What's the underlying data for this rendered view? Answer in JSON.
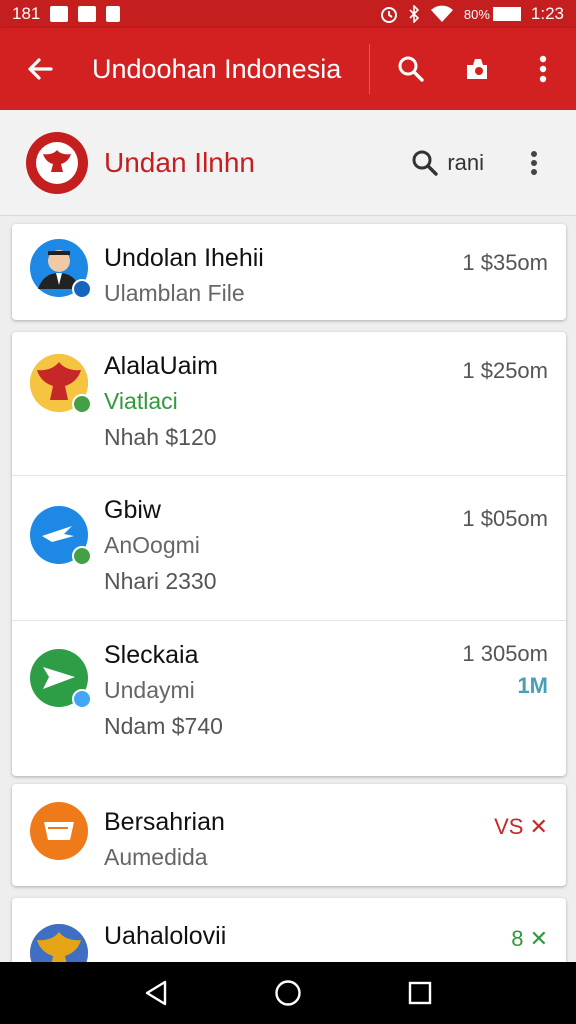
{
  "status_bar": {
    "left_text": "181",
    "battery": "80%",
    "time": "1:23"
  },
  "app_bar": {
    "title": "Undoohan Indonesia"
  },
  "subheader": {
    "title": "Undan Ilnhn",
    "search_label": "rani"
  },
  "items": [
    {
      "name": "Undolan Ihehii",
      "line2": "Ulamblan File",
      "line3": "",
      "meta": "1 $35om",
      "meta_color": "#555555",
      "avatar_color": "#1e88e5",
      "badge_color": "#1565c0"
    },
    {
      "name": "AlalaUaim",
      "line2": "Viatlaci",
      "line3": "Nhah $120",
      "meta": "1 $25om",
      "meta_color": "#555555",
      "avatar_color": "#e6a417",
      "badge_color": "#43a047",
      "line2_color": "#2e9a3a"
    },
    {
      "name": "Gbiw",
      "line2": "AnOogmi",
      "line3": "Nhari 2330",
      "meta": "1 $05om",
      "meta_color": "#555555",
      "avatar_color": "#1e88e5",
      "badge_color": "#43a047"
    },
    {
      "name": "Sleckaia",
      "line2": "Undaymi",
      "line3": "Ndam $740",
      "meta": "1 305om",
      "meta2": "1M",
      "meta_color": "#555555",
      "meta2_color": "#4a9fb8",
      "avatar_color": "#2e9e46",
      "badge_color": "#42a5f5"
    },
    {
      "name": "Bersahrian",
      "line2": "Aumedida",
      "line3": "",
      "meta": "VS ✕",
      "meta_color": "#c62828",
      "avatar_color": "#ef7a1a"
    },
    {
      "name": "Uahalolovii",
      "line2": "",
      "line3": "",
      "meta": "8 ✕",
      "meta_color": "#2e9a3a",
      "avatar_color": "#d4a017"
    }
  ],
  "colors": {
    "primary": "#d32121",
    "status": "#c41e1e"
  }
}
